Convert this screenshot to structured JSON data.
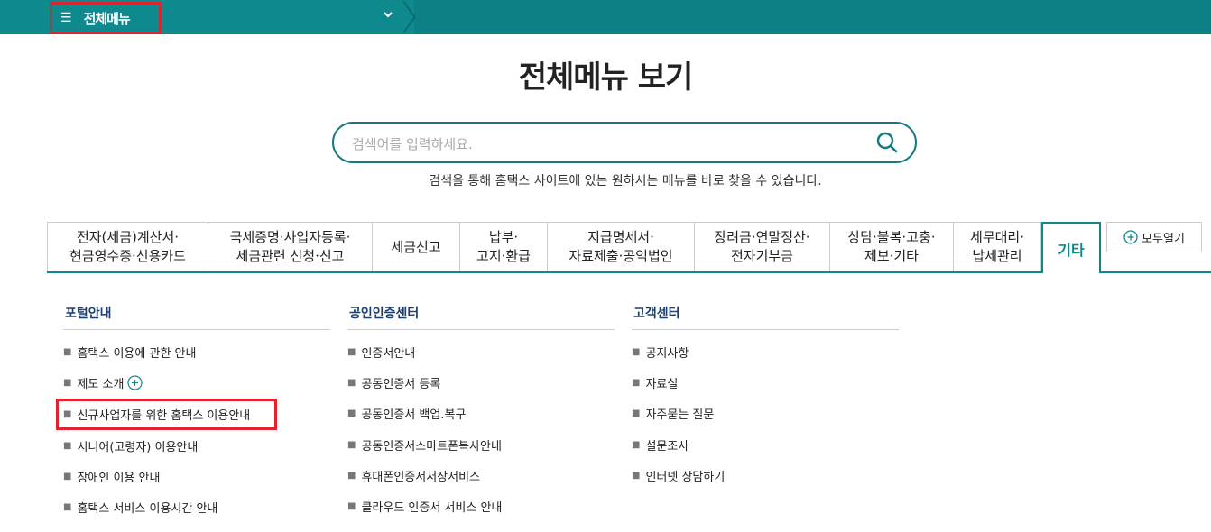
{
  "topbar": {
    "menu_label": "전체메뉴",
    "menu_icon": "hamburger-icon",
    "dropdown_icon": "chevron-down-icon",
    "color": "#0e8a8f"
  },
  "page": {
    "title": "전체메뉴 보기"
  },
  "search": {
    "placeholder": "검색어를 입력하세요.",
    "hint": "검색을 통해 홈택스 사이트에 있는 원하시는 메뉴를 바로 찾을 수 있습니다."
  },
  "tabs": [
    {
      "line1": "전자(세금)계산서·",
      "line2": "현금영수증·신용카드"
    },
    {
      "line1": "국세증명·사업자등록·",
      "line2": "세금관련 신청·신고"
    },
    {
      "line1": "세금신고",
      "line2": ""
    },
    {
      "line1": "납부·",
      "line2": "고지·환급"
    },
    {
      "line1": "지급명세서·",
      "line2": "자료제출·공익법인"
    },
    {
      "line1": "장려금·연말정산·",
      "line2": "전자기부금"
    },
    {
      "line1": "상담·불복·고충·",
      "line2": "제보·기타"
    },
    {
      "line1": "세무대리·",
      "line2": "납세관리"
    }
  ],
  "active_tab": "기타",
  "expand_all_label": "모두열기",
  "columns": [
    {
      "title": "포털안내",
      "items": [
        "홈택스 이용에 관한 안내",
        "제도 소개",
        "신규사업자를 위한 홈택스 이용안내",
        "시니어(고령자) 이용안내",
        "장애인 이용 안내",
        "홈택스 서비스 이용시간 안내"
      ]
    },
    {
      "title": "공인인증센터",
      "items": [
        "인증서안내",
        "공동인증서 등록",
        "공동인증서 백업.복구",
        "공동인증서스마트폰복사안내",
        "휴대폰인증서저장서비스",
        "클라우드 인증서 서비스 안내"
      ]
    },
    {
      "title": "고객센터",
      "items": [
        "공지사항",
        "자료실",
        "자주묻는 질문",
        "설문조사",
        "인터넷 상담하기"
      ]
    }
  ]
}
